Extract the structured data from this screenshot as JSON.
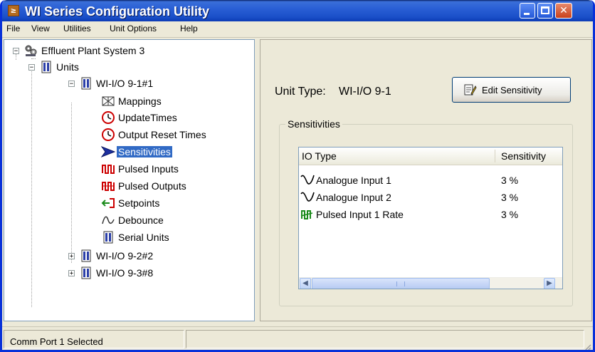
{
  "window": {
    "title": "WI Series Configuration Utility",
    "app_icon_glyph": "≥"
  },
  "menu": [
    {
      "label": "File"
    },
    {
      "label": "View"
    },
    {
      "label": "Utilities"
    },
    {
      "label": "Unit Options"
    },
    {
      "label": "Help"
    }
  ],
  "tree": {
    "root": "Effluent Plant System 3",
    "units": "Units",
    "unit1": "WI-I/O 9-1#1",
    "children": [
      "Mappings",
      "UpdateTimes",
      "Output Reset Times",
      "Sensitivities",
      "Pulsed Inputs",
      "Pulsed Outputs",
      "Setpoints",
      "Debounce",
      "Serial Units"
    ],
    "unit2": "WI-I/O 9-2#2",
    "unit3": "WI-I/O 9-3#8",
    "selected": "Sensitivities"
  },
  "detail": {
    "unit_type_label": "Unit Type:",
    "unit_type_value": "WI-I/O 9-1",
    "edit_button": "Edit Sensitivity",
    "group_title": "Sensitivities",
    "columns": [
      "IO Type",
      "Sensitivity"
    ],
    "rows": [
      {
        "io_type": "Analogue Input 1",
        "sensitivity": "3 %",
        "icon": "analogue-wave-icon"
      },
      {
        "io_type": "Analogue Input 2",
        "sensitivity": "3 %",
        "icon": "analogue-wave-icon"
      },
      {
        "io_type": "Pulsed Input 1 Rate",
        "sensitivity": "3 %",
        "icon": "pulsed-rate-icon"
      }
    ]
  },
  "status": {
    "text": "Comm Port 1 Selected"
  },
  "colors": {
    "title_bar": "#2a5fd5",
    "selection": "#316ac5",
    "window_bg": "#ece9d8"
  }
}
